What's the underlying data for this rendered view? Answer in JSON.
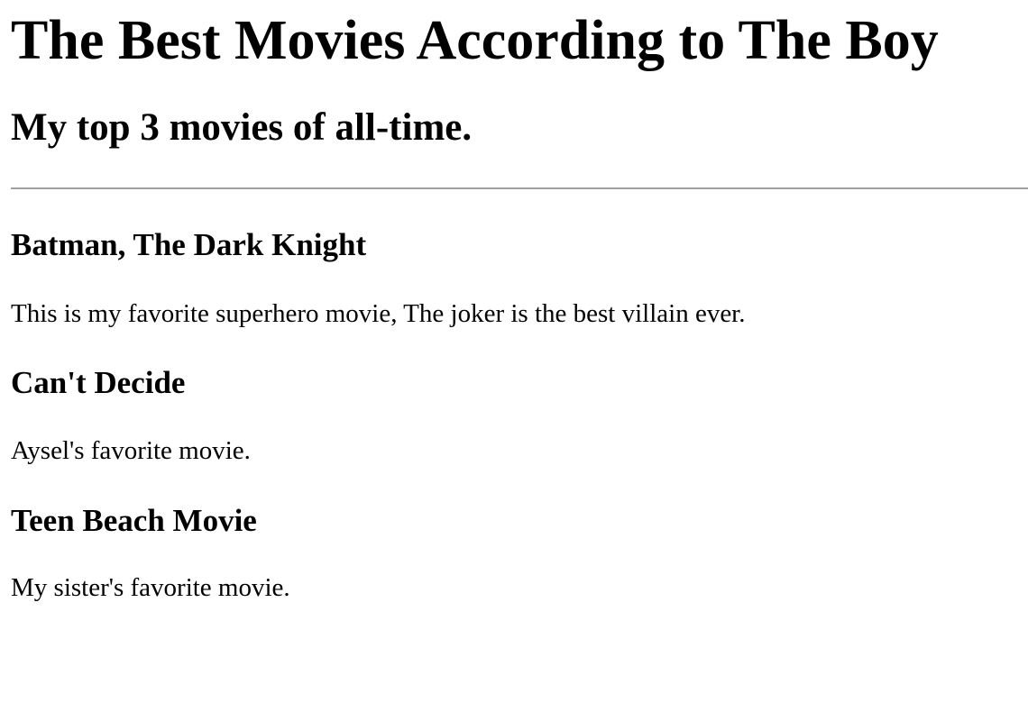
{
  "page": {
    "title": "The Best Movies According to The Boy",
    "subtitle": "My top 3 movies of all-time."
  },
  "movies": [
    {
      "title": "Batman, The Dark Knight",
      "description": "This is my favorite superhero movie, The joker is the best villain ever."
    },
    {
      "title": "Can't Decide",
      "description": "Aysel's favorite movie."
    },
    {
      "title": "Teen Beach Movie",
      "description": "My sister's favorite movie."
    }
  ]
}
